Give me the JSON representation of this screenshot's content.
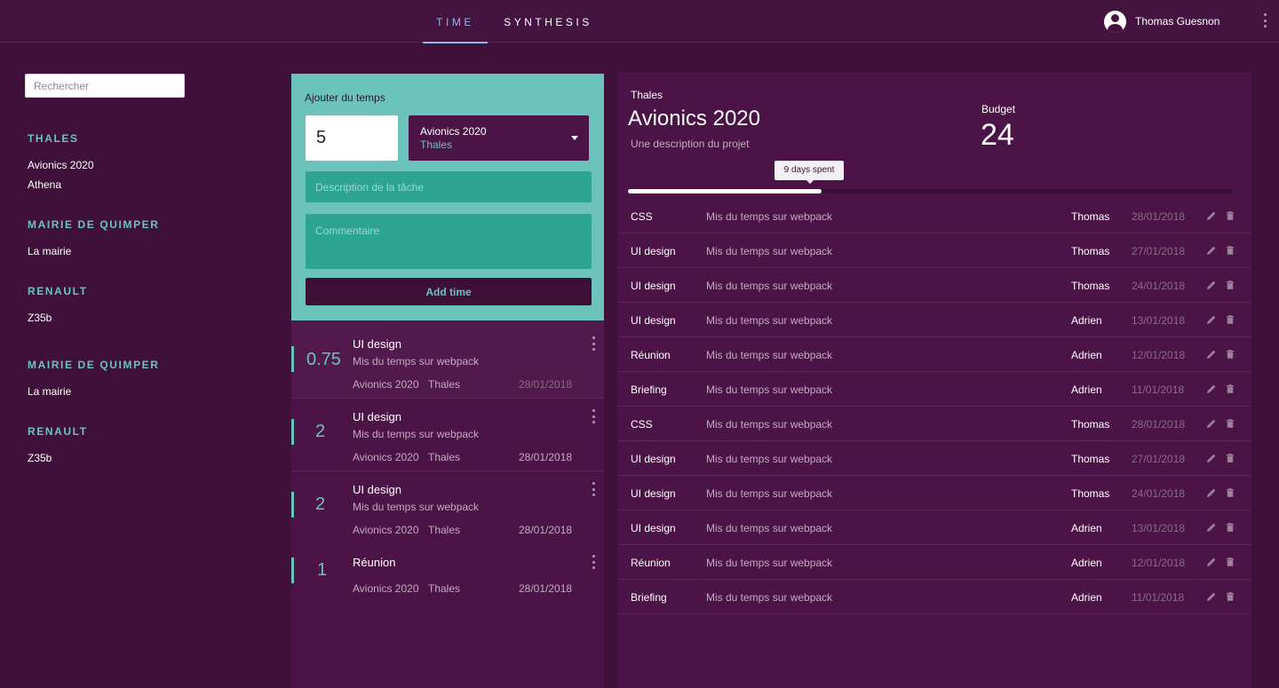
{
  "header": {
    "tabs": [
      {
        "label": "TIME",
        "active": true
      },
      {
        "label": "SYNTHESIS",
        "active": false
      }
    ],
    "user_name": "Thomas Guesnon",
    "icons": {
      "user": "user-avatar-icon",
      "menu": "more-vert-icon"
    },
    "colors": {
      "active_tab": "#8fb6e6"
    }
  },
  "sidebar": {
    "search_placeholder": "Rechercher",
    "groups": [
      {
        "title": "THALES",
        "items": [
          "Avionics 2020",
          "Athena"
        ]
      },
      {
        "title": "MAIRIE DE QUIMPER",
        "items": [
          "La mairie"
        ]
      },
      {
        "title": "RENAULT",
        "items": [
          "Z35b"
        ]
      },
      {
        "title": "MAIRIE DE QUIMPER",
        "items": [
          "La mairie"
        ]
      },
      {
        "title": "RENAULT",
        "items": [
          "Z35b"
        ]
      }
    ]
  },
  "add_form": {
    "title": "Ajouter du temps",
    "quantity": "5",
    "project": "Avionics 2020",
    "client": "Thales",
    "description_placeholder": "Description de la tâche",
    "comment_placeholder": "Commentaire",
    "button_label": "Add time",
    "colors": {
      "panel": "#6cc3bb",
      "field": "#2ca594"
    }
  },
  "entries": [
    {
      "quantity": "0.75",
      "title": "UI design",
      "description": "Mis du temps sur webpack",
      "project": "Avionics 2020",
      "client": "Thales",
      "date": "28/01/2018"
    },
    {
      "quantity": "2",
      "title": "UI design",
      "description": "Mis du temps sur webpack",
      "project": "Avionics 2020",
      "client": "Thales",
      "date": "28/01/2018"
    },
    {
      "quantity": "2",
      "title": "UI design",
      "description": "Mis du temps sur webpack",
      "project": "Avionics 2020",
      "client": "Thales",
      "date": "28/01/2018"
    },
    {
      "quantity": "1",
      "title": "Réunion",
      "description": "",
      "project": "Avionics 2020",
      "client": "Thales",
      "date": "28/01/2018"
    }
  ],
  "detail": {
    "client": "Thales",
    "title": "Avionics 2020",
    "description": "Une description du projet",
    "budget_label": "Budget",
    "budget": "24",
    "spent_label": "9 days spent",
    "spent_fraction": 0.32,
    "tasks": [
      {
        "name": "CSS",
        "description": "Mis du temps sur webpack",
        "user": "Thomas",
        "date": "28/01/2018"
      },
      {
        "name": "UI design",
        "description": "Mis du temps sur webpack",
        "user": "Thomas",
        "date": "27/01/2018"
      },
      {
        "name": "UI design",
        "description": "Mis du temps sur webpack",
        "user": "Thomas",
        "date": "24/01/2018"
      },
      {
        "name": "UI design",
        "description": "Mis du temps sur webpack",
        "user": "Adrien",
        "date": "13/01/2018"
      },
      {
        "name": "Réunion",
        "description": "Mis du temps sur webpack",
        "user": "Adrien",
        "date": "12/01/2018"
      },
      {
        "name": "Briefing",
        "description": "Mis du temps sur webpack",
        "user": "Adrien",
        "date": "11/01/2018"
      },
      {
        "name": "CSS",
        "description": "Mis du temps sur webpack",
        "user": "Thomas",
        "date": "28/01/2018"
      },
      {
        "name": "UI design",
        "description": "Mis du temps sur webpack",
        "user": "Thomas",
        "date": "27/01/2018"
      },
      {
        "name": "UI design",
        "description": "Mis du temps sur webpack",
        "user": "Thomas",
        "date": "24/01/2018"
      },
      {
        "name": "UI design",
        "description": "Mis du temps sur webpack",
        "user": "Adrien",
        "date": "13/01/2018"
      },
      {
        "name": "Réunion",
        "description": "Mis du temps sur webpack",
        "user": "Adrien",
        "date": "12/01/2018"
      },
      {
        "name": "Briefing",
        "description": "Mis du temps sur webpack",
        "user": "Adrien",
        "date": "11/01/2018"
      }
    ],
    "row_icons": {
      "edit": "pencil-icon",
      "delete": "trash-icon"
    }
  }
}
